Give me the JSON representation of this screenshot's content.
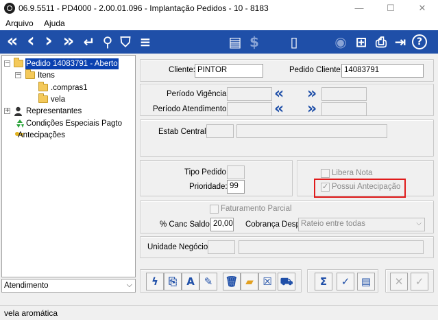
{
  "window": {
    "title": "06.9.5511 - PD4000 - 2.00.01.096 - Implantação Pedidos - 10 - 8183",
    "minimize": "—",
    "maximize": "☐",
    "close": "✕"
  },
  "menu": {
    "items": [
      "Arquivo",
      "Ajuda"
    ]
  },
  "toolbar": {
    "first": "«",
    "prev": "‹",
    "next": "›",
    "last": "»",
    "return": "↵",
    "search": "⚲",
    "filter": "⛉",
    "settings": "≡",
    "report": "▤",
    "money": "$",
    "document": "▯",
    "web": "◉",
    "tree": "⊞",
    "print": "⎙",
    "exit": "⇥",
    "help": "?"
  },
  "tree": {
    "root": "Pedido 14083791 - Aberto",
    "itens": "Itens",
    "item1": ".compras1",
    "item2": "vela",
    "representantes": "Representantes",
    "condicoes": "Condições Especiais Pagto",
    "antecipacoes": "Antecipações"
  },
  "atendimento": {
    "label": "Atendimento",
    "arrow": "⌵"
  },
  "form": {
    "cliente_label": "Cliente:",
    "cliente_value": "PINTOR",
    "pedido_cliente_label": "Pedido Cliente:",
    "pedido_cliente_value": "14083791",
    "periodo_vigencia_label": "Período Vigência:",
    "periodo_atendimento_label": "Período Atendimento:",
    "chev_left": "«",
    "chev_right": "»",
    "estab_central_label": "Estab Central:",
    "tipo_pedido_label": "Tipo Pedido:",
    "prioridade_label": "Prioridade:",
    "prioridade_value": "99",
    "libera_nota_label": "Libera Nota",
    "possui_antecipacao_label": "Possui Antecipação",
    "check_mark": "✓",
    "faturamento_parcial_label": "Faturamento Parcial",
    "canc_saldo_label": "% Canc Saldo:",
    "canc_saldo_value": "20,00",
    "cobranca_label": "Cobrança Desp:",
    "cobranca_value": "Rateio entre todas",
    "unidade_negocio_label": "Unidade Negócio:",
    "dropdown_arrow": "⌵"
  },
  "actions": {
    "lightning": "ϟ",
    "copy": "⎘",
    "translate": "A",
    "edit": "✎",
    "delete": "🗑",
    "folder": "▰",
    "cancel": "☒",
    "truck": "⛟",
    "sum": "Σ",
    "confirm": "✓",
    "doc": "▤",
    "close_x": "✕",
    "close_check": "✓"
  },
  "status": {
    "text": "vela aromática"
  },
  "colors": {
    "toolbar_bg": "#1f4fa8",
    "selected_bg": "#0a41b0",
    "highlight": "#e01b1b"
  }
}
